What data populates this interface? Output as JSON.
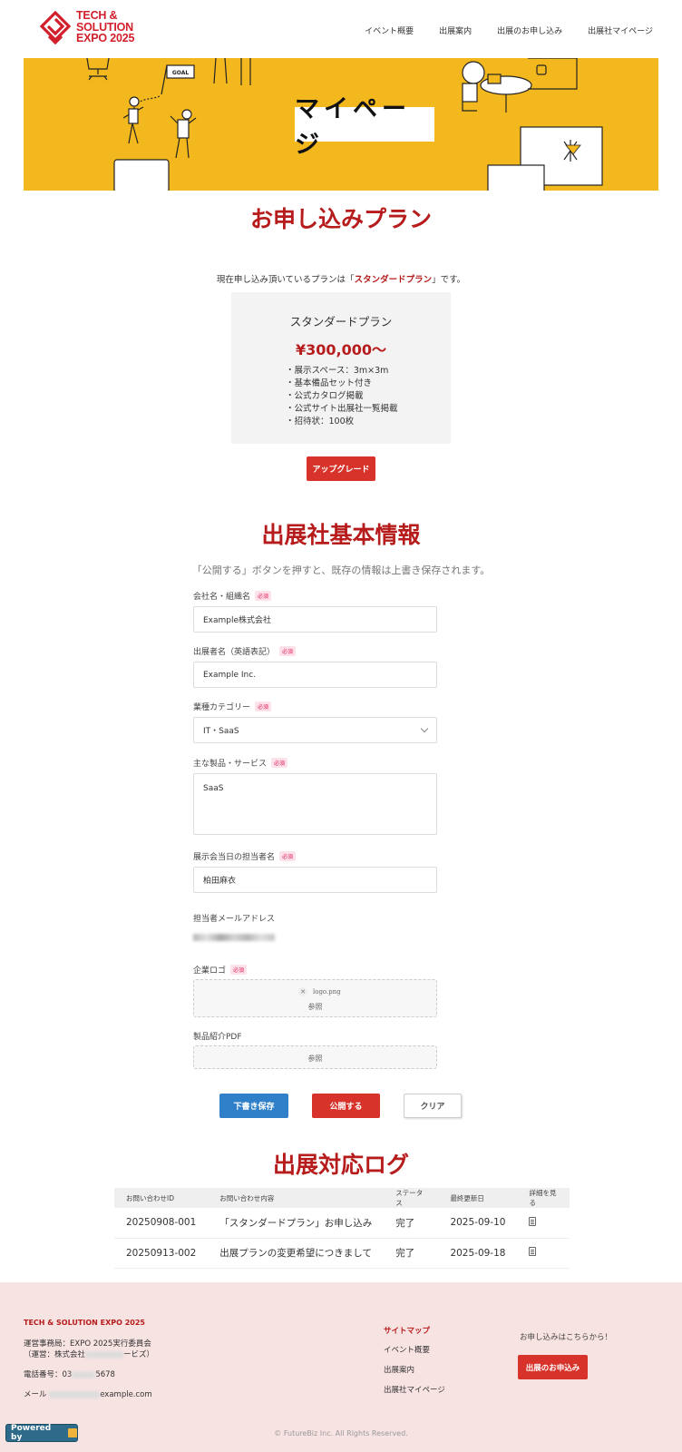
{
  "header": {
    "logo_text": "TECH & SOLUTION EXPO 2025",
    "nav": [
      "イベント概要",
      "出展案内",
      "出展のお申し込み",
      "出展社マイページ"
    ]
  },
  "hero": {
    "title": "マイページ",
    "goal_sign": "GOAL"
  },
  "plan_section": {
    "title": "お申し込みプラン",
    "note_prefix": "現在申し込み頂いているプランは「",
    "note_plan": "スタンダードプラン",
    "note_suffix": "」です。",
    "card": {
      "name": "スタンダードプラン",
      "price": "¥300,000〜",
      "features": [
        "・展示スペース：3m×3m",
        "・基本備品セット付き",
        "・公式カタログ掲載",
        "・公式サイト出展社一覧掲載",
        "・招待状：100枚"
      ]
    },
    "upgrade_label": "アップグレード"
  },
  "exhibitor_section": {
    "title": "出展社基本情報",
    "note": "「公開する」ボタンを押すと、既存の情報は上書き保存されます。",
    "required_badge": "必須",
    "fields": {
      "company_label": "会社名・組織名",
      "company_value": "Example株式会社",
      "exhibitor_en_label": "出展者名（英語表記）",
      "exhibitor_en_value": "Example Inc.",
      "category_label": "業種カテゴリー",
      "category_value": "IT・SaaS",
      "products_label": "主な製品・サービス",
      "products_value": "SaaS",
      "contact_label": "展示会当日の担当者名",
      "contact_value": "柏田麻衣",
      "email_label": "担当者メールアドレス",
      "logo_label": "企業ロゴ",
      "logo_file": "logo.png",
      "logo_browse": "参照",
      "pdf_label": "製品紹介PDF",
      "pdf_browse": "参照"
    },
    "buttons": {
      "draft": "下書き保存",
      "publish": "公開する",
      "clear": "クリア"
    }
  },
  "log_section": {
    "title": "出展対応ログ",
    "columns": [
      "お問い合わせID",
      "お問い合わせ内容",
      "ステータス",
      "最終更新日",
      "詳細を見る"
    ],
    "rows": [
      {
        "id": "20250908-001",
        "content": "「スタンダードプラン」お申し込み",
        "status": "完了",
        "updated": "2025-09-10"
      },
      {
        "id": "20250913-002",
        "content": "出展プランの変更希望につきまして",
        "status": "完了",
        "updated": "2025-09-18"
      }
    ]
  },
  "footer": {
    "brand": "TECH & SOLUTION EXPO 2025",
    "office_line1": "運営事務局：EXPO 2025実行委員会",
    "office_line2_prefix": "（運営：株式会社",
    "office_line2_suffix": "ービズ）",
    "phone_prefix": "電話番号：03",
    "phone_suffix": "5678",
    "mail_prefix": "メール",
    "mail_suffix": "example.com",
    "sitemap_title": "サイトマップ",
    "sitemap_links": [
      "イベント概要",
      "出展案内",
      "出展社マイページ"
    ],
    "apply_note": "お申し込みはこちらから！",
    "apply_button": "出展のお申込み",
    "copyright": "© FutureBiz Inc. All Rights Reserved.",
    "powered_by": "Powered by"
  },
  "colors": {
    "brand_red": "#d21f2b",
    "title_red": "#b71c1c",
    "hero_yellow": "#f4b81f",
    "button_blue": "#2f80c9",
    "footer_bg": "#f8e3e3"
  }
}
